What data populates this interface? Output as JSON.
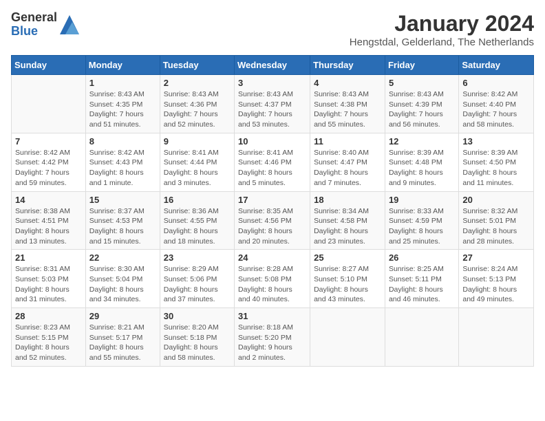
{
  "logo": {
    "general": "General",
    "blue": "Blue"
  },
  "header": {
    "month": "January 2024",
    "location": "Hengstdal, Gelderland, The Netherlands"
  },
  "weekdays": [
    "Sunday",
    "Monday",
    "Tuesday",
    "Wednesday",
    "Thursday",
    "Friday",
    "Saturday"
  ],
  "weeks": [
    [
      {
        "day": "",
        "sunrise": "",
        "sunset": "",
        "daylight": ""
      },
      {
        "day": "1",
        "sunrise": "Sunrise: 8:43 AM",
        "sunset": "Sunset: 4:35 PM",
        "daylight": "Daylight: 7 hours and 51 minutes."
      },
      {
        "day": "2",
        "sunrise": "Sunrise: 8:43 AM",
        "sunset": "Sunset: 4:36 PM",
        "daylight": "Daylight: 7 hours and 52 minutes."
      },
      {
        "day": "3",
        "sunrise": "Sunrise: 8:43 AM",
        "sunset": "Sunset: 4:37 PM",
        "daylight": "Daylight: 7 hours and 53 minutes."
      },
      {
        "day": "4",
        "sunrise": "Sunrise: 8:43 AM",
        "sunset": "Sunset: 4:38 PM",
        "daylight": "Daylight: 7 hours and 55 minutes."
      },
      {
        "day": "5",
        "sunrise": "Sunrise: 8:43 AM",
        "sunset": "Sunset: 4:39 PM",
        "daylight": "Daylight: 7 hours and 56 minutes."
      },
      {
        "day": "6",
        "sunrise": "Sunrise: 8:42 AM",
        "sunset": "Sunset: 4:40 PM",
        "daylight": "Daylight: 7 hours and 58 minutes."
      }
    ],
    [
      {
        "day": "7",
        "sunrise": "Sunrise: 8:42 AM",
        "sunset": "Sunset: 4:42 PM",
        "daylight": "Daylight: 7 hours and 59 minutes."
      },
      {
        "day": "8",
        "sunrise": "Sunrise: 8:42 AM",
        "sunset": "Sunset: 4:43 PM",
        "daylight": "Daylight: 8 hours and 1 minute."
      },
      {
        "day": "9",
        "sunrise": "Sunrise: 8:41 AM",
        "sunset": "Sunset: 4:44 PM",
        "daylight": "Daylight: 8 hours and 3 minutes."
      },
      {
        "day": "10",
        "sunrise": "Sunrise: 8:41 AM",
        "sunset": "Sunset: 4:46 PM",
        "daylight": "Daylight: 8 hours and 5 minutes."
      },
      {
        "day": "11",
        "sunrise": "Sunrise: 8:40 AM",
        "sunset": "Sunset: 4:47 PM",
        "daylight": "Daylight: 8 hours and 7 minutes."
      },
      {
        "day": "12",
        "sunrise": "Sunrise: 8:39 AM",
        "sunset": "Sunset: 4:48 PM",
        "daylight": "Daylight: 8 hours and 9 minutes."
      },
      {
        "day": "13",
        "sunrise": "Sunrise: 8:39 AM",
        "sunset": "Sunset: 4:50 PM",
        "daylight": "Daylight: 8 hours and 11 minutes."
      }
    ],
    [
      {
        "day": "14",
        "sunrise": "Sunrise: 8:38 AM",
        "sunset": "Sunset: 4:51 PM",
        "daylight": "Daylight: 8 hours and 13 minutes."
      },
      {
        "day": "15",
        "sunrise": "Sunrise: 8:37 AM",
        "sunset": "Sunset: 4:53 PM",
        "daylight": "Daylight: 8 hours and 15 minutes."
      },
      {
        "day": "16",
        "sunrise": "Sunrise: 8:36 AM",
        "sunset": "Sunset: 4:55 PM",
        "daylight": "Daylight: 8 hours and 18 minutes."
      },
      {
        "day": "17",
        "sunrise": "Sunrise: 8:35 AM",
        "sunset": "Sunset: 4:56 PM",
        "daylight": "Daylight: 8 hours and 20 minutes."
      },
      {
        "day": "18",
        "sunrise": "Sunrise: 8:34 AM",
        "sunset": "Sunset: 4:58 PM",
        "daylight": "Daylight: 8 hours and 23 minutes."
      },
      {
        "day": "19",
        "sunrise": "Sunrise: 8:33 AM",
        "sunset": "Sunset: 4:59 PM",
        "daylight": "Daylight: 8 hours and 25 minutes."
      },
      {
        "day": "20",
        "sunrise": "Sunrise: 8:32 AM",
        "sunset": "Sunset: 5:01 PM",
        "daylight": "Daylight: 8 hours and 28 minutes."
      }
    ],
    [
      {
        "day": "21",
        "sunrise": "Sunrise: 8:31 AM",
        "sunset": "Sunset: 5:03 PM",
        "daylight": "Daylight: 8 hours and 31 minutes."
      },
      {
        "day": "22",
        "sunrise": "Sunrise: 8:30 AM",
        "sunset": "Sunset: 5:04 PM",
        "daylight": "Daylight: 8 hours and 34 minutes."
      },
      {
        "day": "23",
        "sunrise": "Sunrise: 8:29 AM",
        "sunset": "Sunset: 5:06 PM",
        "daylight": "Daylight: 8 hours and 37 minutes."
      },
      {
        "day": "24",
        "sunrise": "Sunrise: 8:28 AM",
        "sunset": "Sunset: 5:08 PM",
        "daylight": "Daylight: 8 hours and 40 minutes."
      },
      {
        "day": "25",
        "sunrise": "Sunrise: 8:27 AM",
        "sunset": "Sunset: 5:10 PM",
        "daylight": "Daylight: 8 hours and 43 minutes."
      },
      {
        "day": "26",
        "sunrise": "Sunrise: 8:25 AM",
        "sunset": "Sunset: 5:11 PM",
        "daylight": "Daylight: 8 hours and 46 minutes."
      },
      {
        "day": "27",
        "sunrise": "Sunrise: 8:24 AM",
        "sunset": "Sunset: 5:13 PM",
        "daylight": "Daylight: 8 hours and 49 minutes."
      }
    ],
    [
      {
        "day": "28",
        "sunrise": "Sunrise: 8:23 AM",
        "sunset": "Sunset: 5:15 PM",
        "daylight": "Daylight: 8 hours and 52 minutes."
      },
      {
        "day": "29",
        "sunrise": "Sunrise: 8:21 AM",
        "sunset": "Sunset: 5:17 PM",
        "daylight": "Daylight: 8 hours and 55 minutes."
      },
      {
        "day": "30",
        "sunrise": "Sunrise: 8:20 AM",
        "sunset": "Sunset: 5:18 PM",
        "daylight": "Daylight: 8 hours and 58 minutes."
      },
      {
        "day": "31",
        "sunrise": "Sunrise: 8:18 AM",
        "sunset": "Sunset: 5:20 PM",
        "daylight": "Daylight: 9 hours and 2 minutes."
      },
      {
        "day": "",
        "sunrise": "",
        "sunset": "",
        "daylight": ""
      },
      {
        "day": "",
        "sunrise": "",
        "sunset": "",
        "daylight": ""
      },
      {
        "day": "",
        "sunrise": "",
        "sunset": "",
        "daylight": ""
      }
    ]
  ]
}
